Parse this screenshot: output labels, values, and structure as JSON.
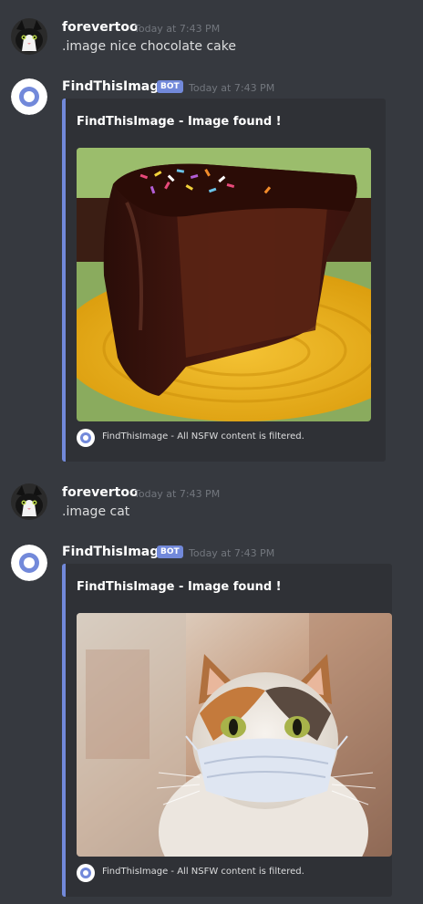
{
  "messages": [
    {
      "author": "forevertoo",
      "timestamp": "Today at 7:43 PM",
      "text": ".image nice chocolate cake",
      "avatar_icon": "cat-avatar-icon"
    },
    {
      "author": "FindThisImage",
      "bot_tag": "BOT",
      "timestamp": "Today at 7:43 PM",
      "avatar_icon": "bot-avatar-icon",
      "embed": {
        "title": "FindThisImage - Image found !",
        "image": "chocolate-cake-image",
        "footer_text": "FindThisImage - All NSFW content is filtered.",
        "accent_color": "#7289da"
      }
    },
    {
      "author": "forevertoo",
      "timestamp": "Today at 7:43 PM",
      "text": ".image cat",
      "avatar_icon": "cat-avatar-icon"
    },
    {
      "author": "FindThisImage",
      "bot_tag": "BOT",
      "timestamp": "Today at 7:43 PM",
      "avatar_icon": "bot-avatar-icon",
      "embed": {
        "title": "FindThisImage - Image found !",
        "image": "cat-with-mask-image",
        "footer_text": "FindThisImage - All NSFW content is filtered.",
        "accent_color": "#7289da"
      }
    }
  ],
  "colors": {
    "background": "#36393f",
    "embed_background": "#2f3136",
    "bot_tag": "#7289da",
    "username": "#ffffff",
    "message_text": "#dcddde",
    "timestamp": "#72767d"
  }
}
